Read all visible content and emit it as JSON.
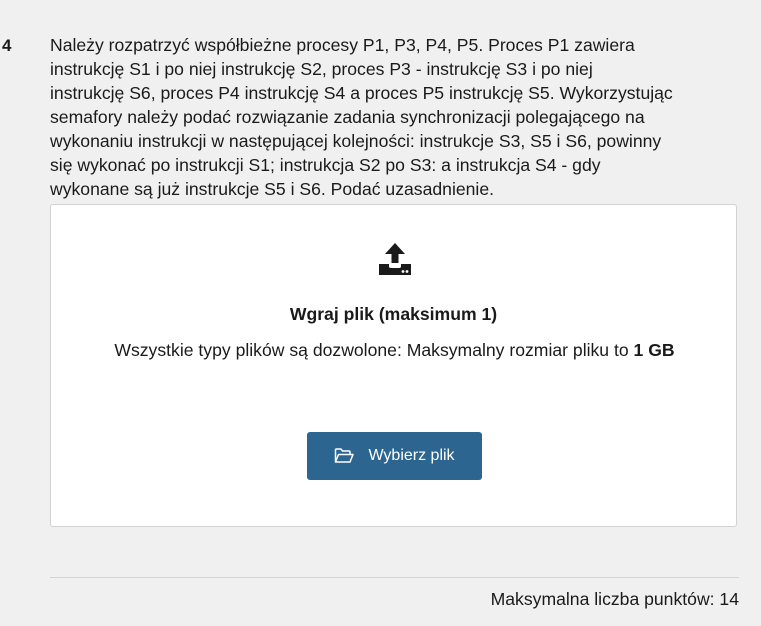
{
  "question": {
    "number": "4",
    "text": "Należy rozpatrzyć współbieżne procesy P1, P3, P4, P5. Proces P1 zawiera\ninstrukcję S1 i po niej instrukcję S2,  proces P3  - instrukcję S3 i po niej\ninstrukcję S6, proces P4 instrukcję S4 a proces P5 instrukcję S5. Wykorzystując\nsemafory należy podać rozwiązanie zadania synchronizacji polegającego na\nwykonaniu instrukcji w następującej kolejności: instrukcje S3, S5 i  S6, powinny\nsię wykonać po instrukcji S1; instrukcja S2 po S3: a instrukcja S4 - gdy\nwykonane są już  instrukcje S5 i S6. Podać uzasadnienie."
  },
  "upload": {
    "icon": "upload-icon",
    "title": "Wgraj plik (maksimum 1)",
    "info_text": "Wszystkie typy plików są dozwolone: Maksymalny rozmiar pliku to ",
    "max_size": "1 GB",
    "button_icon": "folder-open-icon",
    "button_label": "Wybierz plik",
    "button_color": "#2c6690"
  },
  "footer": {
    "max_points": "Maksymalna liczba punktów: 14"
  }
}
